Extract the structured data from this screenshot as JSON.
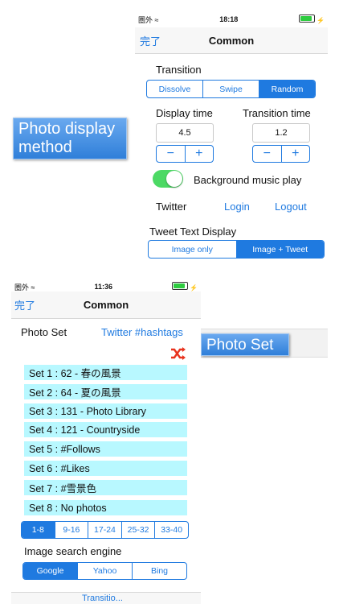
{
  "screenA": {
    "status": {
      "carrier": "圏外",
      "time": "18:18"
    },
    "nav": {
      "done": "完了",
      "title": "Common"
    },
    "transition_label": "Transition",
    "transition_options": [
      "Dissolve",
      "Swipe",
      "Random"
    ],
    "transition_selected": "Random",
    "display_time_label": "Display time",
    "display_time_value": "4.5",
    "transition_time_label": "Transition time",
    "transition_time_value": "1.2",
    "stepper_minus": "−",
    "stepper_plus": "+",
    "bgm_label": "Background music play",
    "bgm_on": true,
    "twitter_label": "Twitter",
    "login": "Login",
    "logout": "Logout",
    "tweet_text_label": "Tweet Text Display",
    "tweet_options": [
      "Image only",
      "Image + Tweet"
    ],
    "tweet_selected": "Image + Tweet"
  },
  "callouts": {
    "photo_display": "Photo display method",
    "photo_set": "Photo Set"
  },
  "screenB": {
    "status": {
      "carrier": "圏外",
      "time": "11:36"
    },
    "nav": {
      "done": "完了",
      "title": "Common"
    },
    "photo_set_label": "Photo Set",
    "hashtags_link": "Twitter #hashtags",
    "sets": [
      "Set 1 : 62 - 春の風景",
      "Set 2 : 64 - 夏の風景",
      "Set 3 : 131 - Photo Library",
      "Set 4 : 121 - Countryside",
      "Set 5 : #Follows",
      "Set 6 : #Likes",
      "Set 7 : #雪景色",
      "Set 8 : No photos"
    ],
    "pages": [
      "1-8",
      "9-16",
      "17-24",
      "25-32",
      "33-40"
    ],
    "page_selected": "1-8",
    "engine_label": "Image search engine",
    "engines": [
      "Google",
      "Yahoo",
      "Bing"
    ],
    "engine_selected": "Google",
    "bottom_partial": "Transitio..."
  },
  "colors": {
    "accent": "#1f7ae0",
    "toggle_on": "#4cd964",
    "set_row_bg": "#b8f8ff",
    "shuffle_icon": "#e8331e"
  }
}
